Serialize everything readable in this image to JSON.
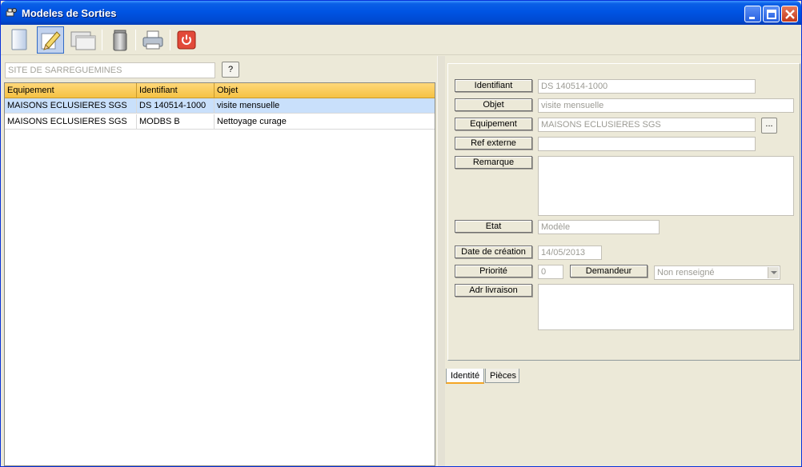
{
  "window": {
    "title": "Modeles de Sorties",
    "app_icon": "gear-printer-icon",
    "minimize": "minimize-icon",
    "maximize": "maximize-icon",
    "close": "close-icon"
  },
  "toolbar": {
    "tools": [
      {
        "name": "new",
        "icon": "new-document-icon"
      },
      {
        "name": "edit",
        "icon": "pencil-edit-icon",
        "active": true
      },
      {
        "name": "windows",
        "icon": "windows-icon"
      },
      {
        "name": "delete",
        "icon": "trash-bin-icon"
      },
      {
        "name": "print",
        "icon": "printer-icon"
      },
      {
        "name": "quit",
        "icon": "power-icon"
      }
    ]
  },
  "left": {
    "site_value": "SITE DE SARREGUEMINES",
    "help_label": "?",
    "columns": [
      "Equipement",
      "Identifiant",
      "Objet"
    ],
    "rows": [
      {
        "equipement": "MAISONS ECLUSIERES SGS",
        "identifiant": "DS 140514-1000",
        "objet": "visite mensuelle",
        "selected": true
      },
      {
        "equipement": "MAISONS ECLUSIERES SGS",
        "identifiant": "MODBS B",
        "objet": "Nettoyage curage",
        "selected": false
      }
    ]
  },
  "form": {
    "identifiant_label": "Identifiant",
    "identifiant_value": "DS 140514-1000",
    "objet_label": "Objet",
    "objet_value": "visite mensuelle",
    "equipement_label": "Equipement",
    "equipement_value": "MAISONS ECLUSIERES SGS",
    "equipement_browse": "...",
    "ref_externe_label": "Ref externe",
    "ref_externe_value": "",
    "remarque_label": "Remarque",
    "remarque_value": "",
    "etat_label": "Etat",
    "etat_value": "Modèle",
    "date_label": "Date de création",
    "date_value": "14/05/2013",
    "priorite_label": "Priorité",
    "priorite_value": "0",
    "demandeur_label": "Demandeur",
    "demandeur_value": "Non renseigné",
    "adr_label": "Adr livraison",
    "adr_value": ""
  },
  "tabs": [
    "Identité",
    "Pièces"
  ]
}
